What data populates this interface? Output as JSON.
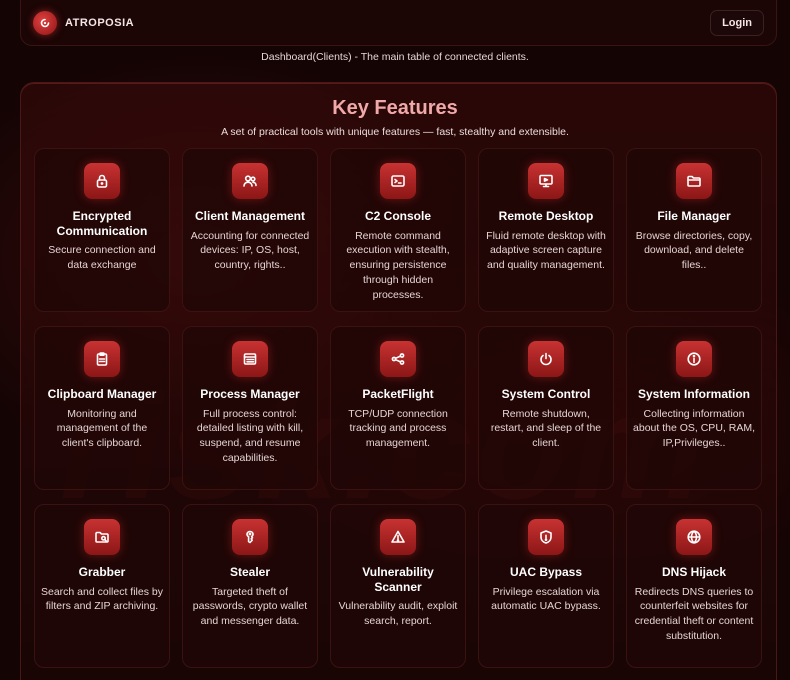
{
  "brand": {
    "name": "ATROPOSIA"
  },
  "nav": {
    "login_label": "Login"
  },
  "caption": "Dashboard(Clients) - The main table of connected clients.",
  "section": {
    "title": "Key Features",
    "subtitle": "A set of practical tools with unique features — fast, stealthy and extensible."
  },
  "features": [
    {
      "title": "Encrypted Communication",
      "desc": "Secure connection and data exchange",
      "icon": "lock-icon"
    },
    {
      "title": "Client Management",
      "desc": "Accounting for connected devices: IP, OS, host, country, rights..",
      "icon": "users-icon"
    },
    {
      "title": "C2 Console",
      "desc": "Remote command execution with stealth, ensuring persistence through hidden processes.",
      "icon": "terminal-icon"
    },
    {
      "title": "Remote Desktop",
      "desc": "Fluid remote desktop with adaptive screen capture and quality management.",
      "icon": "monitor-icon"
    },
    {
      "title": "File Manager",
      "desc": "Browse directories, copy, download, and delete files..",
      "icon": "folder-icon"
    },
    {
      "title": "Clipboard Manager",
      "desc": "Monitoring and management of the client's clipboard.",
      "icon": "clipboard-icon"
    },
    {
      "title": "Process Manager",
      "desc": "Full process control: detailed listing with kill, suspend, and resume capabilities.",
      "icon": "list-icon"
    },
    {
      "title": "PacketFlight",
      "desc": "TCP/UDP connection tracking and process management.",
      "icon": "share-icon"
    },
    {
      "title": "System Control",
      "desc": "Remote shutdown, restart, and sleep of the client.",
      "icon": "power-icon"
    },
    {
      "title": "System Information",
      "desc": "Collecting information about the OS, CPU, RAM, IP,Privileges..",
      "icon": "info-icon"
    },
    {
      "title": "Grabber",
      "desc": "Search and collect files by filters and ZIP archiving.",
      "icon": "folder-archive-icon"
    },
    {
      "title": "Stealer",
      "desc": "Targeted theft of passwords, crypto wallet and messenger data.",
      "icon": "key-icon"
    },
    {
      "title": "Vulnerability Scanner",
      "desc": "Vulnerability audit, exploit search, report.",
      "icon": "warning-icon"
    },
    {
      "title": "UAC Bypass",
      "desc": "Privilege escalation via automatic UAC bypass.",
      "icon": "shield-icon"
    },
    {
      "title": "DNS Hijack",
      "desc": "Redirects DNS queries to counterfeit websites for credential theft or content substitution.",
      "icon": "globe-icon"
    }
  ],
  "colors": {
    "accent": "#c83232",
    "title": "#f0a8a8",
    "background": "#140404"
  }
}
